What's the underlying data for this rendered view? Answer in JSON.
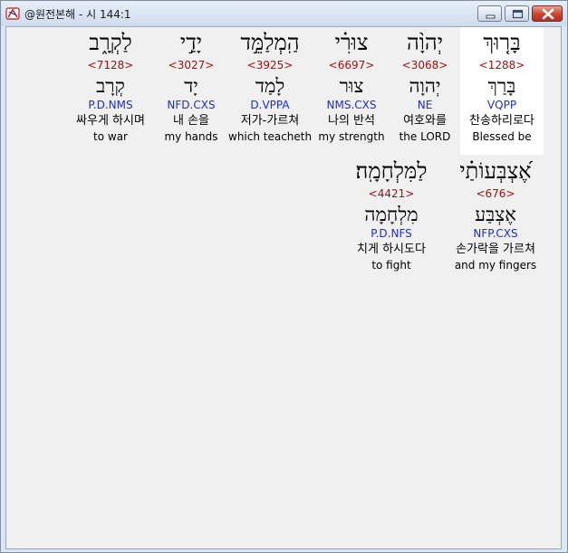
{
  "window": {
    "title": "@원전본해 - 시 144:1"
  },
  "words": [
    {
      "hebrew": "בָּר֤וּךְ",
      "strong": "<1288>",
      "lemma": "בָּרַךְ",
      "morph": "VQPP",
      "korean": "찬송하리로다",
      "english": "Blessed be",
      "selected": true
    },
    {
      "hebrew": "יְהוָ֨ה",
      "strong": "<3068>",
      "lemma": "יְהוָה",
      "morph": "NE",
      "korean": "여호와를",
      "english": "the LORD",
      "selected": false
    },
    {
      "hebrew": "צוּרִ֗י",
      "strong": "<6697>",
      "lemma": "צוּר",
      "morph": "NMS.CXS",
      "korean": "나의 반석",
      "english": "my strength",
      "selected": false
    },
    {
      "hebrew": "הַֽמְלַמֵּ֣ד",
      "strong": "<3925>",
      "lemma": "לָמַד",
      "morph": "D.VPPA",
      "korean": "저가-가르쳐",
      "english": "which teacheth",
      "selected": false
    },
    {
      "hebrew": "יָדַ֣י",
      "strong": "<3027>",
      "lemma": "יָד",
      "morph": "NFD.CXS",
      "korean": "내 손을",
      "english": "my hands",
      "selected": false
    },
    {
      "hebrew": "לַקְרָ֑ב",
      "strong": "<7128>",
      "lemma": "קְרָב",
      "morph": "P.D.NMS",
      "korean": "싸우게 하시며",
      "english": "to war",
      "selected": false
    },
    {
      "hebrew": "אֶ֝צְבְּעוֹתַ֗י",
      "strong": "<676>",
      "lemma": "אֶצְבַּע",
      "morph": "NFP.CXS",
      "korean": "손가락을 가르쳐",
      "english": "and my fingers",
      "selected": false
    },
    {
      "hebrew": "לַמִּלְחָמָֽה׃",
      "strong": "<4421>",
      "lemma": "מִלְחָמָה",
      "morph": "P.D.NFS",
      "korean": "치게 하시도다",
      "english": "to fight",
      "selected": false
    }
  ]
}
